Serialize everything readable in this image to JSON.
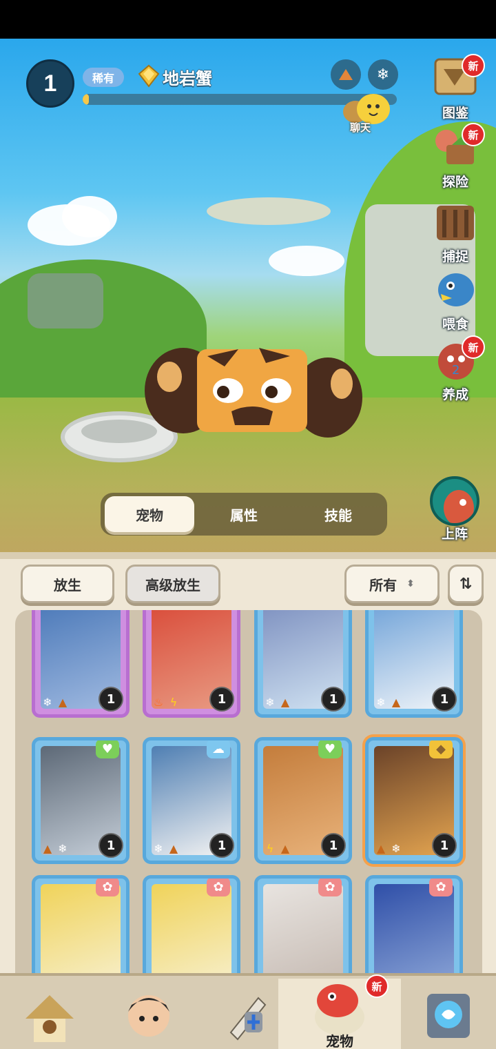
{
  "header": {
    "level": "1",
    "rarity": "稀有",
    "pet_name": "地岩蟹",
    "progress_fraction": 0.02,
    "chat_label": "聊天"
  },
  "side_menu": [
    {
      "label": "图鉴",
      "badge": "新"
    },
    {
      "label": "探险",
      "badge": "新"
    },
    {
      "label": "捕捉",
      "badge": ""
    },
    {
      "label": "喂食",
      "badge": ""
    },
    {
      "label": "养成",
      "badge": "新"
    }
  ],
  "tabs": [
    "宠物",
    "属性",
    "技能"
  ],
  "deploy_label": "上阵",
  "toolbar": {
    "release_label": "放生",
    "advanced_release_label": "高级放生",
    "filter_label": "所有",
    "sort_icon": "⇅"
  },
  "cards_row1": [
    {
      "level": "1",
      "elements": [
        "ice",
        "earth"
      ]
    },
    {
      "level": "1",
      "elements": [
        "fire",
        "bolt"
      ]
    },
    {
      "level": "1",
      "elements": [
        "ice",
        "earth"
      ]
    },
    {
      "level": "1",
      "elements": [
        "ice",
        "earth"
      ]
    }
  ],
  "cards_row2": [
    {
      "level": "1",
      "elements": [
        "earth",
        "ice"
      ]
    },
    {
      "level": "1",
      "elements": [
        "ice",
        "earth"
      ]
    },
    {
      "level": "1",
      "elements": [
        "bolt",
        "earth"
      ]
    },
    {
      "level": "1",
      "elements": [
        "earth",
        "ice"
      ]
    }
  ],
  "bottom_nav": {
    "active_label": "宠物",
    "active_badge": "新"
  }
}
